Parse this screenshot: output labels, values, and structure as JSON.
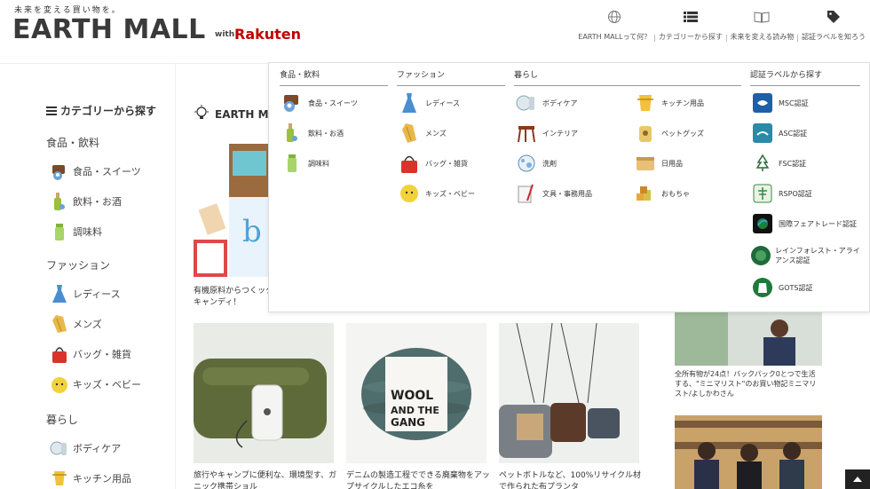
{
  "header": {
    "tagline": "未来を変える買い物を。",
    "logo": "EARTH MALL",
    "logo_with": "with",
    "logo_partner": "Rakuten",
    "nav": [
      {
        "label": "EARTH MALLって何？",
        "icon": "globe-icon"
      },
      {
        "label": "カテゴリーから探す",
        "icon": "list-icon"
      },
      {
        "label": "未来を変える読み物",
        "icon": "book-icon"
      },
      {
        "label": "認証ラベルを知ろう",
        "icon": "tag-icon"
      }
    ],
    "nav_sep": "|"
  },
  "sidebar": {
    "title": "カテゴリーから探す",
    "groups": {
      "food": "食品・飲料",
      "fashion": "ファッション",
      "living": "暮らし"
    },
    "items": [
      {
        "label": "食品・スイーツ"
      },
      {
        "label": "飲料・お酒"
      },
      {
        "label": "調味料"
      },
      {
        "label": "レディース"
      },
      {
        "label": "メンズ"
      },
      {
        "label": "バッグ・雑貨"
      },
      {
        "label": "キッズ・ベビー"
      },
      {
        "label": "ボディケア"
      },
      {
        "label": "キッチン用品"
      }
    ]
  },
  "feature": {
    "heading": "EARTH MA",
    "caption": "有機原料からつくックキャンディ！"
  },
  "cards": [
    {
      "caption": "旅行やキャンプに便利な、環境型す、ガニック携帯ショル"
    },
    {
      "caption": "デニムの製造工程でできる廃棄物をアップサイクルしたエコ糸を"
    },
    {
      "caption": "ペットボトルなど、100%リサイクル材で作られた布プランタ"
    }
  ],
  "right_articles": [
    {
      "caption": "全所有物が24点！バックパック0とつで生活する、\"ミニマリスト\"のお買い物記ミニマリスト/よしかわさん"
    }
  ],
  "mega_menu": {
    "columns": {
      "food": "食品・飲料",
      "fashion": "ファッション",
      "living": "暮らし",
      "cert": "認証ラベルから探す"
    },
    "food": [
      "食品・スイーツ",
      "飲料・お酒",
      "調味料"
    ],
    "fashion": [
      "レディース",
      "メンズ",
      "バッグ・雑貨",
      "キッズ・ベビー"
    ],
    "living_a": [
      "ボディケア",
      "インテリア",
      "洗剤",
      "文具・事務用品"
    ],
    "living_b": [
      "キッチン用品",
      "ペットグッズ",
      "日用品",
      "おもちゃ"
    ],
    "cert": [
      "MSC認証",
      "ASC認証",
      "FSC認証",
      "RSPO認証",
      "国際フェアトレード認証",
      "レインフォレスト・アライアンス認証",
      "GOTS認証"
    ]
  },
  "colors": {
    "brand_red": "#bf0000",
    "msc_blue": "#1f5fa6",
    "asc_teal": "#2a8aa8",
    "fairtrade_green": "#1d7f3a"
  }
}
